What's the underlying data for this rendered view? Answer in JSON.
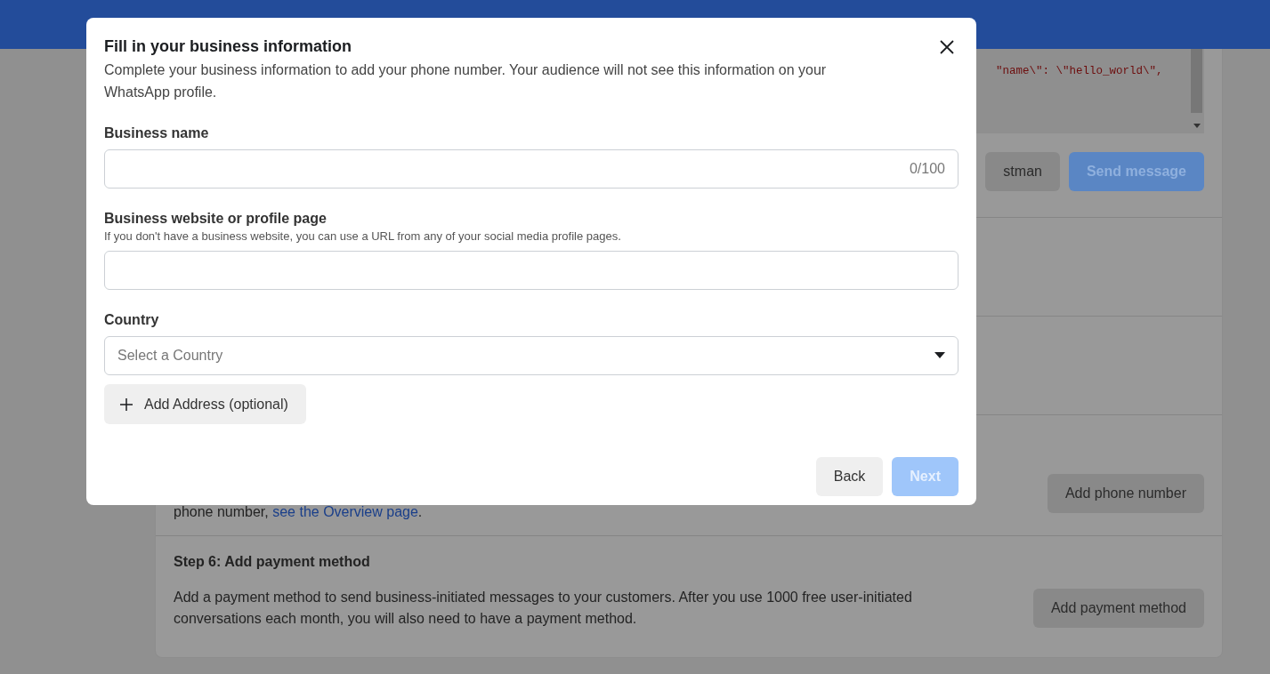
{
  "background": {
    "code_line": "\"name\\\": \\\"hello_world\\\",",
    "code_buttons": [
      {
        "label": "stman",
        "kind": "secondary"
      },
      {
        "label": "Send message",
        "kind": "primary",
        "disabled": true
      }
    ],
    "step5": {
      "text_before": "phone number, ",
      "link": "see the Overview page",
      "text_after": ".",
      "button": "Add phone number"
    },
    "step6": {
      "title": "Step 6: Add payment method",
      "body": "Add a payment method to send business-initiated messages to your customers. After you use 1000 free user-initiated conversations each month, you will also need to have a payment method.",
      "button": "Add payment method"
    }
  },
  "modal": {
    "title": "Fill in your business information",
    "description": "Complete your business information to add your phone number. Your audience will not see this information on your WhatsApp profile.",
    "fields": [
      {
        "kind": "text",
        "label": "Business name",
        "counter": "0/100"
      },
      {
        "kind": "text",
        "label": "Business website or profile page",
        "helper": "If you don't have a business website, you can use a URL from any of your social media profile pages."
      },
      {
        "kind": "select",
        "label": "Country",
        "placeholder": "Select a Country"
      }
    ],
    "add_address": "Add Address (optional)",
    "buttons": [
      {
        "label": "Back",
        "kind": "secondary"
      },
      {
        "label": "Next",
        "kind": "primary",
        "disabled": true
      }
    ]
  }
}
